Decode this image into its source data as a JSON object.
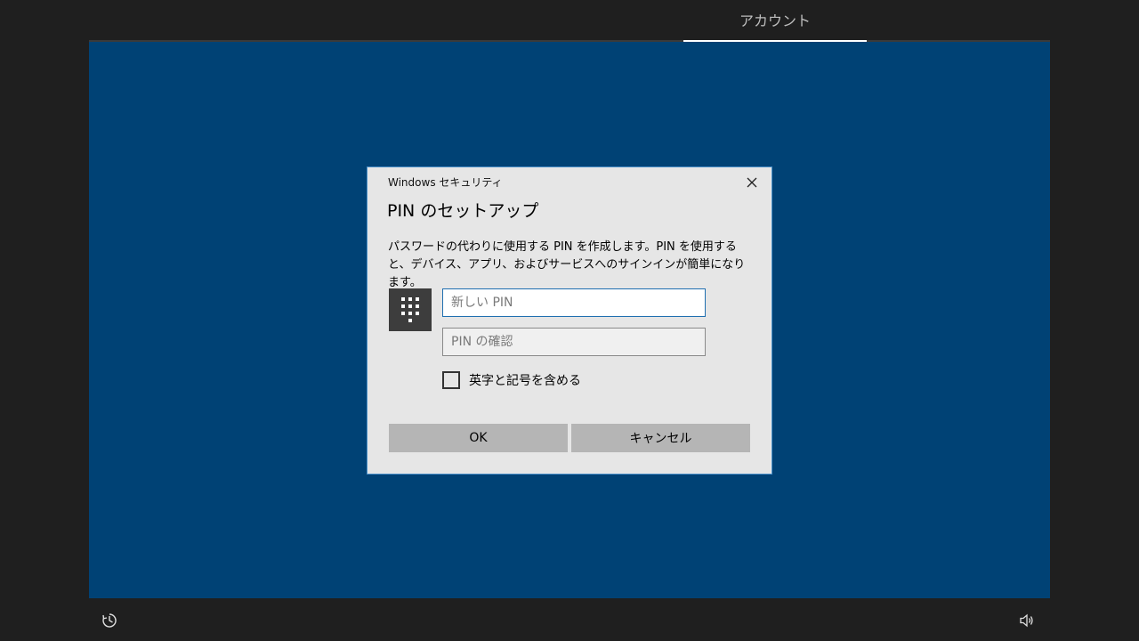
{
  "top_tab": {
    "label": "アカウント"
  },
  "dialog": {
    "source": "Windows セキュリティ",
    "title": "PIN のセットアップ",
    "description": "パスワードの代わりに使用する PIN を作成します。PIN を使用すると、デバイス、アプリ、およびサービスへのサインインが簡単になります。",
    "new_pin": {
      "value": "",
      "placeholder": "新しい PIN"
    },
    "confirm_pin": {
      "value": "",
      "placeholder": "PIN の確認"
    },
    "include_letters": {
      "label": "英字と記号を含める",
      "checked": false
    },
    "ok_label": "OK",
    "cancel_label": "キャンセル",
    "close_icon": "close-icon",
    "keypad_icon": "keypad-icon"
  },
  "bottom_bar": {
    "left_icon": "ease-of-access-icon",
    "right_icon": "volume-icon"
  },
  "colors": {
    "background": "#1f1f1f",
    "oobe_blue": "#004275",
    "dialog_bg": "#e6e6e6",
    "button_bg": "#b5b5b5",
    "accent": "#1f6fb0"
  }
}
